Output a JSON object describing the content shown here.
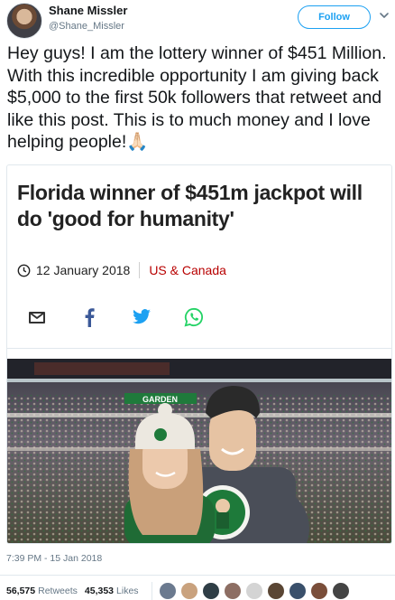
{
  "user": {
    "name": "Shane Missler",
    "handle": "@Shane_Missler",
    "follow_label": "Follow"
  },
  "tweet": {
    "text": "Hey guys! I am the lottery winner of $451 Million. With this incredible opportunity I am giving back $5,000 to the first 50k followers that retweet and like this post. This is to much money and I love helping people!",
    "emoji": "🙏🏻"
  },
  "card": {
    "headline": "Florida winner of $451m jackpot will do 'good for humanity'",
    "date": "12 January 2018",
    "category": "US & Canada",
    "share_icons": [
      "email-icon",
      "facebook-icon",
      "twitter-icon",
      "whatsapp-icon"
    ],
    "photo_text": "GARDEN"
  },
  "footer": {
    "timestamp": "7:39 PM - 15 Jan 2018",
    "retweets_count": "56,575",
    "retweets_label": "Retweets",
    "likes_count": "45,353",
    "likes_label": "Likes"
  },
  "colors": {
    "accent": "#1da1f2",
    "bbc_red": "#b80000",
    "celtics_green": "#007a33"
  },
  "liker_colors": [
    "#6b7a8f",
    "#c9a27e",
    "#2f3e46",
    "#8d6e63",
    "#d4d4d4",
    "#5a4634",
    "#3a506b",
    "#7a4e3a",
    "#444444"
  ]
}
